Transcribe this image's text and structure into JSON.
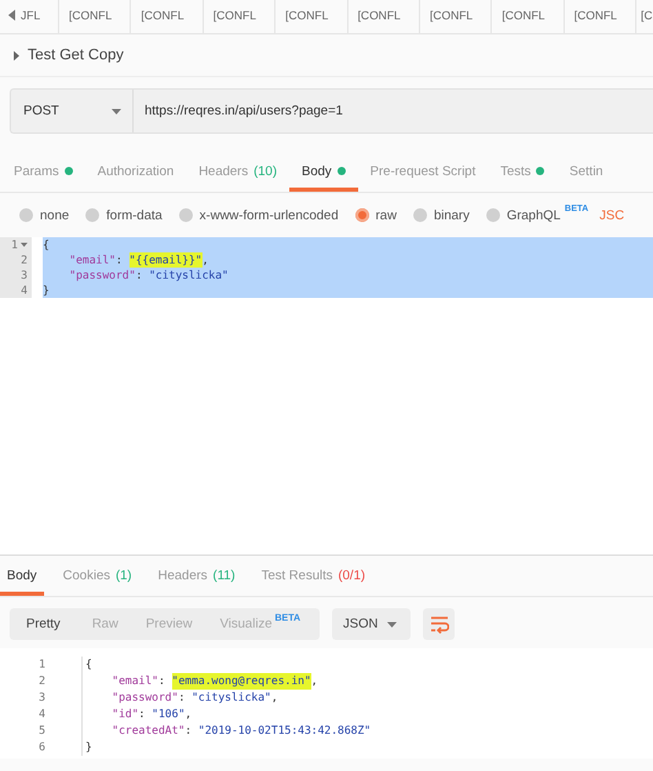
{
  "open_tabs": [
    {
      "label": "JFL",
      "back_arrow": true
    },
    {
      "label": "[CONFL",
      "back_arrow": false
    },
    {
      "label": "[CONFL",
      "back_arrow": false
    },
    {
      "label": "[CONFL",
      "back_arrow": false
    },
    {
      "label": "[CONFL",
      "back_arrow": false
    },
    {
      "label": "[CONFL",
      "back_arrow": false
    },
    {
      "label": "[CONFL",
      "back_arrow": false
    },
    {
      "label": "[CONFL",
      "back_arrow": false
    },
    {
      "label": "[CONFL",
      "back_arrow": false
    },
    {
      "label": "[C",
      "back_arrow": false
    }
  ],
  "request_name": {
    "title": "Test Get Copy",
    "expanded": false
  },
  "request": {
    "method": "POST",
    "url": "https://reqres.in/api/users?page=1"
  },
  "request_tabs": [
    {
      "label": "Params",
      "dot": true,
      "selected": false
    },
    {
      "label": "Authorization",
      "dot": false,
      "selected": false
    },
    {
      "label": "Headers",
      "count": "(10)",
      "color": "#26b47f",
      "dot": false,
      "selected": false
    },
    {
      "label": "Body",
      "dot": true,
      "selected": true
    },
    {
      "label": "Pre-request Script",
      "dot": false,
      "selected": false
    },
    {
      "label": "Tests",
      "dot": true,
      "selected": false
    },
    {
      "label": "Settin",
      "dot": false,
      "selected": false
    }
  ],
  "body_types": [
    {
      "label": "none",
      "selected": false
    },
    {
      "label": "form-data",
      "selected": false
    },
    {
      "label": "x-www-form-urlencoded",
      "selected": false
    },
    {
      "label": "raw",
      "selected": true
    },
    {
      "label": "binary",
      "selected": false
    },
    {
      "label": "GraphQL",
      "badge": "BETA",
      "selected": false
    }
  ],
  "body_language": "JSC",
  "request_body": [
    {
      "number": "1",
      "fold": true,
      "selected": true,
      "tokens": [
        {
          "text": "{",
          "kind": "punct"
        }
      ]
    },
    {
      "number": "2",
      "fold": false,
      "selected": true,
      "tokens": [
        {
          "text": "    \"email\"",
          "kind": "key"
        },
        {
          "text": ": ",
          "kind": "punct"
        },
        {
          "text": "\"{{email}}\"",
          "kind": "string",
          "highlight": true
        },
        {
          "text": ",",
          "kind": "punct"
        }
      ]
    },
    {
      "number": "3",
      "fold": false,
      "selected": true,
      "tokens": [
        {
          "text": "    \"password\"",
          "kind": "key"
        },
        {
          "text": ": ",
          "kind": "punct"
        },
        {
          "text": "\"cityslicka\"",
          "kind": "string"
        }
      ]
    },
    {
      "number": "4",
      "fold": false,
      "selected": true,
      "tokens": [
        {
          "text": "}",
          "kind": "punct"
        }
      ]
    }
  ],
  "response_tabs": [
    {
      "label": "Body",
      "selected": true
    },
    {
      "label": "Cookies",
      "count": "(1)",
      "color": "#26b47f",
      "selected": false
    },
    {
      "label": "Headers",
      "count": "(11)",
      "color": "#26b47f",
      "selected": false
    },
    {
      "label": "Test Results",
      "count": "(0/1)",
      "color": "#ed4b48",
      "selected": false
    }
  ],
  "view_modes": [
    {
      "label": "Pretty",
      "selected": true
    },
    {
      "label": "Raw",
      "selected": false
    },
    {
      "label": "Preview",
      "selected": false
    },
    {
      "label": "Visualize",
      "badge": "BETA",
      "selected": false
    }
  ],
  "response_format": "JSON",
  "response_body": [
    {
      "number": "1",
      "fold": false,
      "selected": false,
      "tokens": [
        {
          "text": "{",
          "kind": "punct"
        }
      ]
    },
    {
      "number": "2",
      "fold": false,
      "selected": false,
      "tokens": [
        {
          "text": "    \"email\"",
          "kind": "key"
        },
        {
          "text": ": ",
          "kind": "punct"
        },
        {
          "text": "\"emma.wong@reqres.in\"",
          "kind": "string",
          "highlight": true
        },
        {
          "text": ",",
          "kind": "punct"
        }
      ]
    },
    {
      "number": "3",
      "fold": false,
      "selected": false,
      "tokens": [
        {
          "text": "    \"password\"",
          "kind": "key"
        },
        {
          "text": ": ",
          "kind": "punct"
        },
        {
          "text": "\"cityslicka\"",
          "kind": "string"
        },
        {
          "text": ",",
          "kind": "punct"
        }
      ]
    },
    {
      "number": "4",
      "fold": false,
      "selected": false,
      "tokens": [
        {
          "text": "    \"id\"",
          "kind": "key"
        },
        {
          "text": ": ",
          "kind": "punct"
        },
        {
          "text": "\"106\"",
          "kind": "string"
        },
        {
          "text": ",",
          "kind": "punct"
        }
      ]
    },
    {
      "number": "5",
      "fold": false,
      "selected": false,
      "tokens": [
        {
          "text": "    \"createdAt\"",
          "kind": "key"
        },
        {
          "text": ": ",
          "kind": "punct"
        },
        {
          "text": "\"2019-10-02T15:43:42.868Z\"",
          "kind": "string"
        }
      ]
    },
    {
      "number": "6",
      "fold": false,
      "selected": false,
      "tokens": [
        {
          "text": "}",
          "kind": "punct"
        }
      ]
    }
  ]
}
